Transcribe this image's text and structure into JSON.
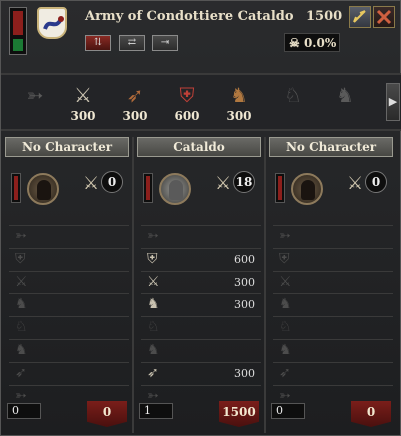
{
  "header": {
    "title": "Army of Condottiere Cataldo",
    "troop_count": "1500",
    "attrition": "0.0%",
    "buttons": [
      "split-button",
      "reorganize-button",
      "detach-button"
    ]
  },
  "unit_bar": [
    {
      "icon": "skirmisher-icon",
      "value": ""
    },
    {
      "icon": "heavy-infantry-icon",
      "value": "300"
    },
    {
      "icon": "archer-icon",
      "value": "300"
    },
    {
      "icon": "pikemen-icon",
      "value": "600"
    },
    {
      "icon": "light-cavalry-icon",
      "value": "300"
    },
    {
      "icon": "knights-icon",
      "value": ""
    },
    {
      "icon": "horse-archer-icon",
      "value": ""
    }
  ],
  "columns": [
    {
      "name": "No Character",
      "skill": "0",
      "has_portrait": false,
      "rows": [
        "",
        "",
        "",
        "",
        "",
        "",
        "",
        ""
      ],
      "active": [
        false,
        false,
        false,
        false,
        false,
        false,
        false,
        false
      ],
      "footer_left": "0",
      "footer_right": "0"
    },
    {
      "name": "Cataldo",
      "skill": "18",
      "has_portrait": true,
      "rows": [
        "",
        "600",
        "300",
        "300",
        "",
        "",
        "300",
        ""
      ],
      "active": [
        false,
        true,
        true,
        true,
        false,
        false,
        true,
        false
      ],
      "footer_left": "1",
      "footer_right": "1500"
    },
    {
      "name": "No Character",
      "skill": "0",
      "has_portrait": false,
      "rows": [
        "",
        "",
        "",
        "",
        "",
        "",
        "",
        ""
      ],
      "active": [
        false,
        false,
        false,
        false,
        false,
        false,
        false,
        false
      ],
      "footer_left": "0",
      "footer_right": "0"
    }
  ],
  "colors": {
    "banner_red": "#8c1f1c",
    "gold_border": "#c9b37a"
  }
}
